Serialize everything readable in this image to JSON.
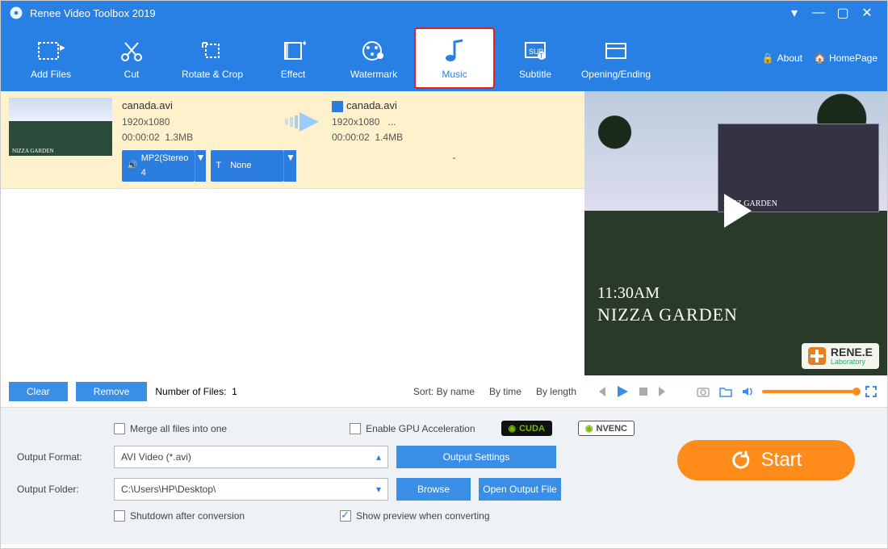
{
  "window": {
    "title": "Renee Video Toolbox 2019"
  },
  "toolbar": {
    "items": [
      {
        "label": "Add Files"
      },
      {
        "label": "Cut"
      },
      {
        "label": "Rotate & Crop"
      },
      {
        "label": "Effect"
      },
      {
        "label": "Watermark"
      },
      {
        "label": "Music"
      },
      {
        "label": "Subtitle"
      },
      {
        "label": "Opening/Ending"
      }
    ],
    "about": "About",
    "homepage": "HomePage"
  },
  "file": {
    "in": {
      "name": "canada.avi",
      "res": "1920x1080",
      "dur": "00:00:02",
      "size": "1.3MB"
    },
    "out": {
      "name": "canada.avi",
      "res": "1920x1080",
      "ext": "...",
      "dur": "00:00:02",
      "size": "1.4MB",
      "dash": "-"
    },
    "audio_tag": "MP2(Stereo 4",
    "sub_tag": "None"
  },
  "listbar": {
    "clear": "Clear",
    "remove": "Remove",
    "count_label": "Number of Files:",
    "count": "1",
    "sort_label": "Sort:",
    "by_name": "By name",
    "by_time": "By time",
    "by_length": "By length"
  },
  "preview": {
    "time": "11:30AM",
    "title": "NIZZA GARDEN",
    "brand": "RENE.E",
    "brand_sub": "Laboratory",
    "inset_label": "NIZZ GARDEN"
  },
  "settings": {
    "merge": "Merge all files into one",
    "gpu": "Enable GPU Acceleration",
    "cuda": "CUDA",
    "nvenc": "NVENC",
    "format_label": "Output Format:",
    "format_value": "AVI Video (*.avi)",
    "output_settings": "Output Settings",
    "folder_label": "Output Folder:",
    "folder_value": "C:\\Users\\HP\\Desktop\\",
    "browse": "Browse",
    "open_folder": "Open Output File",
    "shutdown": "Shutdown after conversion",
    "show_preview": "Show preview when converting"
  },
  "start": "Start",
  "audio_icon_label": "🔊",
  "sub_icon_label": "T"
}
